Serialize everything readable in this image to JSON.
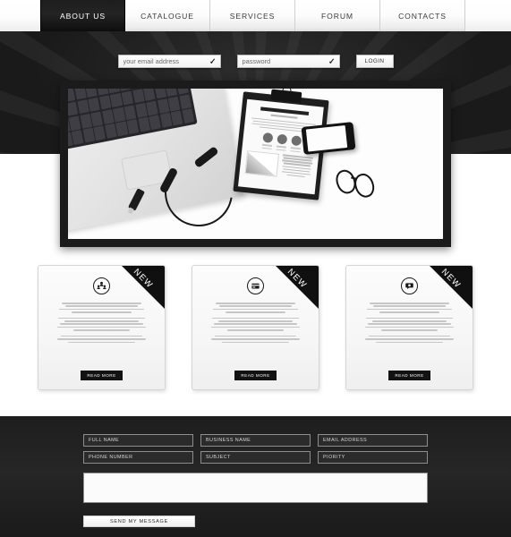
{
  "nav": {
    "items": [
      {
        "label": "ABOUT US",
        "active": true
      },
      {
        "label": "CATALOGUE",
        "active": false
      },
      {
        "label": "SERVICES",
        "active": false
      },
      {
        "label": "FORUM",
        "active": false
      },
      {
        "label": "CONTACTS",
        "active": false
      }
    ]
  },
  "login": {
    "email_placeholder": "your email address",
    "email_value": "",
    "password_placeholder": "password",
    "password_value": "",
    "email_check": "✓",
    "password_check": "✓",
    "login_label": "LOGIN"
  },
  "hero": {
    "alt": "Flat lay desk photo: laptop keyboard, clipboard with report, smartphone, headphones, USB flash drive and eyeglasses"
  },
  "cards": [
    {
      "icon": "group-users-icon",
      "ribbon": "NEW",
      "paragraphs": [
        "Lorem ipsum dolor sit amet, consectetur adipiscing elit. Nunc vitae pulvinar eros. Pellentesque aliquet consectetur congue. Fusce sed auctor orci, a dignissim diam.",
        "Cras tincidunt scelerisque tellus a porttitor. Etiam eu pulvinar elit, in venenatis, metus sit amet pretium porta, nisl justo aliquam arcu, vel imperdiet leo nibh id dui integer ut diam facilisis massa gravida venenatis.",
        "Praesent id sem ullamcorper diam fermentum mollis. Maecenas ac luctus mauris. Sed sodales quis nunc eu turpis consectetur hendrerit."
      ],
      "read_more": "READ MORE"
    },
    {
      "icon": "card-window-icon",
      "ribbon": "NEW",
      "paragraphs": [
        "Lorem ipsum dolor sit amet, consectetur adipiscing elit. Nunc vitae pulvinar eros. Pellentesque aliquet consectetur congue. Fusce sed auctor orci, a dignissim diam.",
        "Cras tincidunt scelerisque tellus a porttitor. Etiam eu pulvinar elit, in venenatis, metus sit amet pretium porta, nisl justo aliquam arcu, vel imperdiet leo nibh id dui integer ut diam facilisis massa gravida venenatis.",
        "Praesent id sem ullamcorper diam fermentum mollis. Maecenas ac luctus mauris. Sed sodales quis nunc eu turpis consectetur hendrerit."
      ],
      "read_more": "READ MORE"
    },
    {
      "icon": "chat-message-icon",
      "ribbon": "NEW",
      "paragraphs": [
        "Lorem ipsum dolor sit amet, consectetur adipiscing elit. Nunc vitae pulvinar eros. Pellentesque aliquet consectetur congue. Fusce sed auctor orci, a dignissim diam.",
        "Cras tincidunt scelerisque tellus a porttitor. Etiam eu pulvinar elit, in venenatis, metus sit amet pretium porta, nisl justo aliquam arcu, vel imperdiet leo nibh id dui integer ut diam facilisis massa gravida venenatis.",
        "Praesent id sem ullamcorper diam fermentum mollis. Maecenas ac luctus mauris. Sed sodales quis nunc eu turpis consectetur hendrerit."
      ],
      "read_more": "READ MORE"
    }
  ],
  "contact_form": {
    "full_name_placeholder": "FULL NAME",
    "full_name_value": "",
    "business_name_placeholder": "BUSINESS NAME",
    "business_name_value": "",
    "email_address_placeholder": "EMAIL ADDRESS",
    "email_address_value": "",
    "phone_number_placeholder": "PHONE NUMBER",
    "phone_number_value": "",
    "subject_placeholder": "SUBJECT",
    "subject_value": "",
    "piority_placeholder": "PIORITY",
    "piority_value": "",
    "message_placeholder": "",
    "message_value": "",
    "submit_label": "SEND MY MESSAGE"
  },
  "colors": {
    "dark": "#1a1a1a",
    "accent_black": "#101010",
    "page_bg": "#ffffff",
    "field_border": "#8d8d8d"
  }
}
